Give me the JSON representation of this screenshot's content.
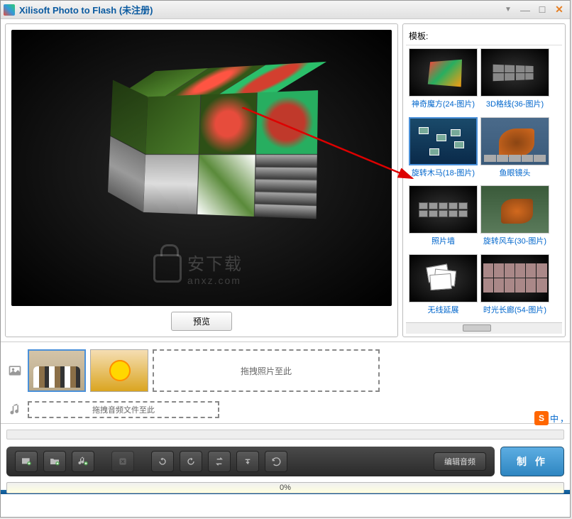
{
  "titlebar": {
    "title": "Xilisoft Photo to Flash (未注册)"
  },
  "preview": {
    "button_label": "预览",
    "watermark_text": "安下载",
    "watermark_url": "anxz.com"
  },
  "templates": {
    "header": "模板:",
    "items": [
      {
        "label": "神奇魔方(24-图片)"
      },
      {
        "label": "3D格线(36-图片)"
      },
      {
        "label": "旋转木马(18-图片)"
      },
      {
        "label": "鱼眼镜头"
      },
      {
        "label": "照片墙"
      },
      {
        "label": "旋转风车(30-图片)"
      },
      {
        "label": "无线延展"
      },
      {
        "label": "时光长廊(54-图片)"
      }
    ]
  },
  "timeline": {
    "photo_drop_hint": "拖拽照片至此",
    "audio_drop_hint": "拖拽音频文件至此"
  },
  "toolbar": {
    "edit_audio_label": "编辑音频",
    "make_label": "制 作"
  },
  "progress": {
    "text": "0%"
  },
  "ime": {
    "badge": "S",
    "lang": "中",
    "punct": "，"
  }
}
